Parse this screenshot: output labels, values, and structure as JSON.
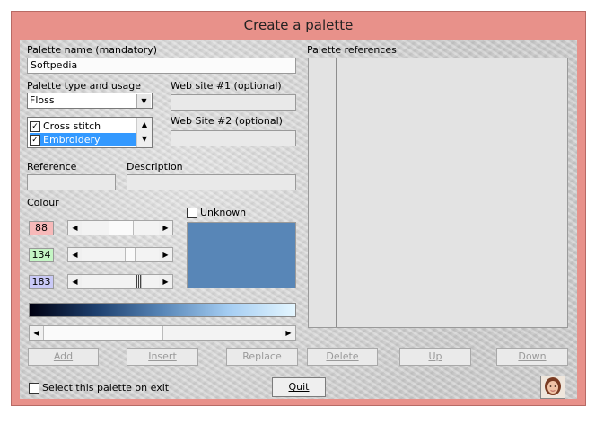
{
  "window": {
    "title": "Create a palette"
  },
  "palette_name": {
    "label": "Palette name (mandatory)",
    "value": "Softpedia"
  },
  "palette_type": {
    "label": "Palette type and usage",
    "selected": "Floss",
    "usages": [
      {
        "label": "Cross stitch",
        "checked": "✓"
      },
      {
        "label": "Embroidery",
        "checked": "✓"
      }
    ]
  },
  "website1": {
    "label": "Web site #1 (optional)",
    "value": ""
  },
  "website2": {
    "label": "Web Site #2 (optional)",
    "value": ""
  },
  "reference": {
    "label": "Reference",
    "value": ""
  },
  "description": {
    "label": "Description",
    "value": ""
  },
  "colour": {
    "label": "Colour",
    "unknown_label": "Unknown",
    "r": "88",
    "g": "134",
    "b": "183",
    "swatch_color": "#5886b7"
  },
  "palette_references": {
    "label": "Palette references"
  },
  "buttons": {
    "add": "Add",
    "insert": "Insert",
    "replace": "Replace",
    "delete": "Delete",
    "up": "Up",
    "down": "Down",
    "quit": "Quit"
  },
  "select_on_exit": {
    "label": "Select this palette on exit"
  },
  "icons": {
    "scroll_left": "◀",
    "scroll_right": "▶",
    "scroll_up": "▲",
    "scroll_down": "▼",
    "combo_arrow": "▼"
  }
}
